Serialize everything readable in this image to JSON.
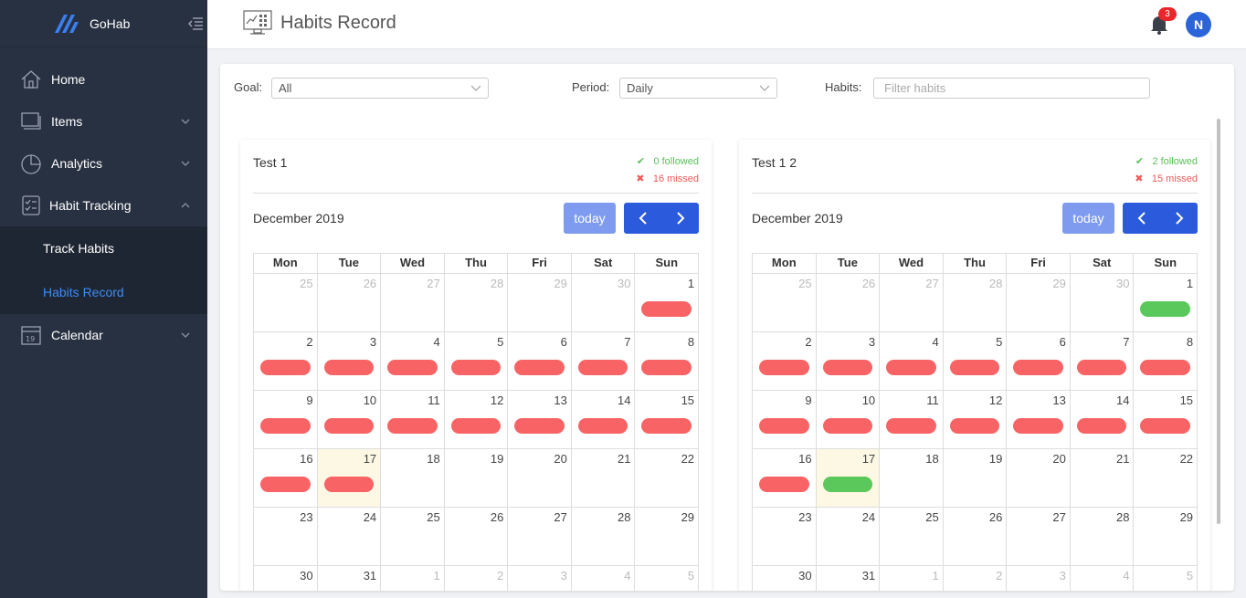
{
  "app": {
    "name": "GoHab"
  },
  "colors": {
    "sidebar": "#283142",
    "accent": "#2b5bdc",
    "missed": "#f86465",
    "followed": "#5bc85b",
    "today_bg": "#fcf8e3"
  },
  "sidebar": {
    "items": [
      {
        "label": "Home",
        "icon": "home-icon"
      },
      {
        "label": "Items",
        "icon": "items-icon"
      },
      {
        "label": "Analytics",
        "icon": "pie-chart-icon"
      },
      {
        "label": "Habit Tracking",
        "icon": "checklist-icon"
      },
      {
        "label": "Calendar",
        "icon": "calendar-icon"
      }
    ],
    "sub_items": [
      {
        "label": "Track Habits"
      },
      {
        "label": "Habits Record"
      }
    ]
  },
  "header": {
    "title": "Habits Record",
    "notification_count": "3",
    "avatar_initial": "N"
  },
  "filters": {
    "goal_label": "Goal:",
    "goal_value": "All",
    "period_label": "Period:",
    "period_value": "Daily",
    "habits_label": "Habits:",
    "habits_placeholder": "Filter habits"
  },
  "weekdays": [
    "Mon",
    "Tue",
    "Wed",
    "Thu",
    "Fri",
    "Sat",
    "Sun"
  ],
  "cards": [
    {
      "title": "Test 1",
      "followed": "0 followed",
      "missed": "16 missed",
      "month": "December 2019",
      "today_label": "today",
      "weeks": [
        [
          {
            "n": "25",
            "o": 1,
            "s": ""
          },
          {
            "n": "26",
            "o": 1,
            "s": ""
          },
          {
            "n": "27",
            "o": 1,
            "s": ""
          },
          {
            "n": "28",
            "o": 1,
            "s": ""
          },
          {
            "n": "29",
            "o": 1,
            "s": ""
          },
          {
            "n": "30",
            "o": 1,
            "s": ""
          },
          {
            "n": "1",
            "o": 0,
            "s": "missed"
          }
        ],
        [
          {
            "n": "2",
            "o": 0,
            "s": "missed"
          },
          {
            "n": "3",
            "o": 0,
            "s": "missed"
          },
          {
            "n": "4",
            "o": 0,
            "s": "missed"
          },
          {
            "n": "5",
            "o": 0,
            "s": "missed"
          },
          {
            "n": "6",
            "o": 0,
            "s": "missed"
          },
          {
            "n": "7",
            "o": 0,
            "s": "missed"
          },
          {
            "n": "8",
            "o": 0,
            "s": "missed"
          }
        ],
        [
          {
            "n": "9",
            "o": 0,
            "s": "missed"
          },
          {
            "n": "10",
            "o": 0,
            "s": "missed"
          },
          {
            "n": "11",
            "o": 0,
            "s": "missed"
          },
          {
            "n": "12",
            "o": 0,
            "s": "missed"
          },
          {
            "n": "13",
            "o": 0,
            "s": "missed"
          },
          {
            "n": "14",
            "o": 0,
            "s": "missed"
          },
          {
            "n": "15",
            "o": 0,
            "s": "missed"
          }
        ],
        [
          {
            "n": "16",
            "o": 0,
            "s": "missed"
          },
          {
            "n": "17",
            "o": 0,
            "s": "missed",
            "t": 1
          },
          {
            "n": "18",
            "o": 0,
            "s": ""
          },
          {
            "n": "19",
            "o": 0,
            "s": ""
          },
          {
            "n": "20",
            "o": 0,
            "s": ""
          },
          {
            "n": "21",
            "o": 0,
            "s": ""
          },
          {
            "n": "22",
            "o": 0,
            "s": ""
          }
        ],
        [
          {
            "n": "23",
            "o": 0,
            "s": ""
          },
          {
            "n": "24",
            "o": 0,
            "s": ""
          },
          {
            "n": "25",
            "o": 0,
            "s": ""
          },
          {
            "n": "26",
            "o": 0,
            "s": ""
          },
          {
            "n": "27",
            "o": 0,
            "s": ""
          },
          {
            "n": "28",
            "o": 0,
            "s": ""
          },
          {
            "n": "29",
            "o": 0,
            "s": ""
          }
        ],
        [
          {
            "n": "30",
            "o": 0,
            "s": ""
          },
          {
            "n": "31",
            "o": 0,
            "s": ""
          },
          {
            "n": "1",
            "o": 1,
            "s": ""
          },
          {
            "n": "2",
            "o": 1,
            "s": ""
          },
          {
            "n": "3",
            "o": 1,
            "s": ""
          },
          {
            "n": "4",
            "o": 1,
            "s": ""
          },
          {
            "n": "5",
            "o": 1,
            "s": ""
          }
        ]
      ]
    },
    {
      "title": "Test 1 2",
      "followed": "2 followed",
      "missed": "15 missed",
      "month": "December 2019",
      "today_label": "today",
      "weeks": [
        [
          {
            "n": "25",
            "o": 1,
            "s": ""
          },
          {
            "n": "26",
            "o": 1,
            "s": ""
          },
          {
            "n": "27",
            "o": 1,
            "s": ""
          },
          {
            "n": "28",
            "o": 1,
            "s": ""
          },
          {
            "n": "29",
            "o": 1,
            "s": ""
          },
          {
            "n": "30",
            "o": 1,
            "s": ""
          },
          {
            "n": "1",
            "o": 0,
            "s": "followed"
          }
        ],
        [
          {
            "n": "2",
            "o": 0,
            "s": "missed"
          },
          {
            "n": "3",
            "o": 0,
            "s": "missed"
          },
          {
            "n": "4",
            "o": 0,
            "s": "missed"
          },
          {
            "n": "5",
            "o": 0,
            "s": "missed"
          },
          {
            "n": "6",
            "o": 0,
            "s": "missed"
          },
          {
            "n": "7",
            "o": 0,
            "s": "missed"
          },
          {
            "n": "8",
            "o": 0,
            "s": "missed"
          }
        ],
        [
          {
            "n": "9",
            "o": 0,
            "s": "missed"
          },
          {
            "n": "10",
            "o": 0,
            "s": "missed"
          },
          {
            "n": "11",
            "o": 0,
            "s": "missed"
          },
          {
            "n": "12",
            "o": 0,
            "s": "missed"
          },
          {
            "n": "13",
            "o": 0,
            "s": "missed"
          },
          {
            "n": "14",
            "o": 0,
            "s": "missed"
          },
          {
            "n": "15",
            "o": 0,
            "s": "missed"
          }
        ],
        [
          {
            "n": "16",
            "o": 0,
            "s": "missed"
          },
          {
            "n": "17",
            "o": 0,
            "s": "followed",
            "t": 1
          },
          {
            "n": "18",
            "o": 0,
            "s": ""
          },
          {
            "n": "19",
            "o": 0,
            "s": ""
          },
          {
            "n": "20",
            "o": 0,
            "s": ""
          },
          {
            "n": "21",
            "o": 0,
            "s": ""
          },
          {
            "n": "22",
            "o": 0,
            "s": ""
          }
        ],
        [
          {
            "n": "23",
            "o": 0,
            "s": ""
          },
          {
            "n": "24",
            "o": 0,
            "s": ""
          },
          {
            "n": "25",
            "o": 0,
            "s": ""
          },
          {
            "n": "26",
            "o": 0,
            "s": ""
          },
          {
            "n": "27",
            "o": 0,
            "s": ""
          },
          {
            "n": "28",
            "o": 0,
            "s": ""
          },
          {
            "n": "29",
            "o": 0,
            "s": ""
          }
        ],
        [
          {
            "n": "30",
            "o": 0,
            "s": ""
          },
          {
            "n": "31",
            "o": 0,
            "s": ""
          },
          {
            "n": "1",
            "o": 1,
            "s": ""
          },
          {
            "n": "2",
            "o": 1,
            "s": ""
          },
          {
            "n": "3",
            "o": 1,
            "s": ""
          },
          {
            "n": "4",
            "o": 1,
            "s": ""
          },
          {
            "n": "5",
            "o": 1,
            "s": ""
          }
        ]
      ]
    }
  ]
}
